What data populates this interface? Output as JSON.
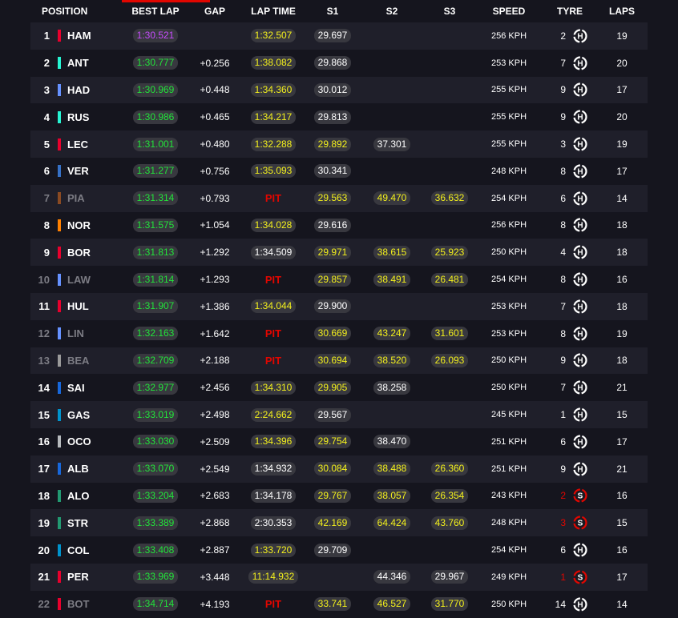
{
  "header": {
    "position": "POSITION",
    "best_lap": "BEST LAP",
    "gap": "GAP",
    "lap_time": "LAP TIME",
    "s1": "S1",
    "s2": "S2",
    "s3": "S3",
    "speed": "SPEED",
    "tyre": "TYRE",
    "laps": "LAPS"
  },
  "colors": {
    "background": "#15151e",
    "row_alt": "#1f1f2a",
    "pill": "#38383f",
    "green": "#22e33a",
    "purple": "#c84cff",
    "yellow": "#f3f01c",
    "red": "#e10600"
  },
  "pit_label": "PIT",
  "rows": [
    {
      "pos": "1",
      "driver": "HAM",
      "team_color": "#e8002d",
      "best": "1:30.521",
      "best_color": "purple",
      "gap": "",
      "lap": "1:32.507",
      "lap_color": "yellow",
      "s1": "29.697",
      "s1_color": "white",
      "s2": "",
      "s2_color": "",
      "s3": "",
      "s3_color": "",
      "speed": "256 KPH",
      "tyre_laps": "2",
      "tyre": "H",
      "laps": "19",
      "dim": false
    },
    {
      "pos": "2",
      "driver": "ANT",
      "team_color": "#27f4d2",
      "best": "1:30.777",
      "best_color": "green",
      "gap": "+0.256",
      "lap": "1:38.082",
      "lap_color": "yellow",
      "s1": "29.868",
      "s1_color": "white",
      "s2": "",
      "s2_color": "",
      "s3": "",
      "s3_color": "",
      "speed": "253 KPH",
      "tyre_laps": "7",
      "tyre": "H",
      "laps": "20",
      "dim": false
    },
    {
      "pos": "3",
      "driver": "HAD",
      "team_color": "#6692ff",
      "best": "1:30.969",
      "best_color": "green",
      "gap": "+0.448",
      "lap": "1:34.360",
      "lap_color": "yellow",
      "s1": "30.012",
      "s1_color": "white",
      "s2": "",
      "s2_color": "",
      "s3": "",
      "s3_color": "",
      "speed": "255 KPH",
      "tyre_laps": "9",
      "tyre": "H",
      "laps": "17",
      "dim": false
    },
    {
      "pos": "4",
      "driver": "RUS",
      "team_color": "#27f4d2",
      "best": "1:30.986",
      "best_color": "green",
      "gap": "+0.465",
      "lap": "1:34.217",
      "lap_color": "yellow",
      "s1": "29.813",
      "s1_color": "white",
      "s2": "",
      "s2_color": "",
      "s3": "",
      "s3_color": "",
      "speed": "255 KPH",
      "tyre_laps": "9",
      "tyre": "H",
      "laps": "20",
      "dim": false
    },
    {
      "pos": "5",
      "driver": "LEC",
      "team_color": "#e8002d",
      "best": "1:31.001",
      "best_color": "green",
      "gap": "+0.480",
      "lap": "1:32.288",
      "lap_color": "yellow",
      "s1": "29.892",
      "s1_color": "yellow",
      "s2": "37.301",
      "s2_color": "white",
      "s3": "",
      "s3_color": "",
      "speed": "255 KPH",
      "tyre_laps": "3",
      "tyre": "H",
      "laps": "19",
      "dim": false
    },
    {
      "pos": "6",
      "driver": "VER",
      "team_color": "#3671c6",
      "best": "1:31.277",
      "best_color": "green",
      "gap": "+0.756",
      "lap": "1:35.093",
      "lap_color": "yellow",
      "s1": "30.341",
      "s1_color": "white",
      "s2": "",
      "s2_color": "",
      "s3": "",
      "s3_color": "",
      "speed": "248 KPH",
      "tyre_laps": "8",
      "tyre": "H",
      "laps": "17",
      "dim": false
    },
    {
      "pos": "7",
      "driver": "PIA",
      "team_color": "#8a4a22",
      "best": "1:31.314",
      "best_color": "green",
      "gap": "+0.793",
      "lap": "PIT",
      "lap_color": "pit",
      "s1": "29.563",
      "s1_color": "yellow",
      "s2": "49.470",
      "s2_color": "yellow",
      "s3": "36.632",
      "s3_color": "yellow",
      "speed": "254 KPH",
      "tyre_laps": "6",
      "tyre": "H",
      "laps": "14",
      "dim": true
    },
    {
      "pos": "8",
      "driver": "NOR",
      "team_color": "#ff8000",
      "best": "1:31.575",
      "best_color": "green",
      "gap": "+1.054",
      "lap": "1:34.028",
      "lap_color": "yellow",
      "s1": "29.616",
      "s1_color": "white",
      "s2": "",
      "s2_color": "",
      "s3": "",
      "s3_color": "",
      "speed": "256 KPH",
      "tyre_laps": "8",
      "tyre": "H",
      "laps": "18",
      "dim": false
    },
    {
      "pos": "9",
      "driver": "BOR",
      "team_color": "#e8002d",
      "best": "1:31.813",
      "best_color": "green",
      "gap": "+1.292",
      "lap": "1:34.509",
      "lap_color": "white",
      "s1": "29.971",
      "s1_color": "yellow",
      "s2": "38.615",
      "s2_color": "yellow",
      "s3": "25.923",
      "s3_color": "yellow",
      "speed": "250 KPH",
      "tyre_laps": "4",
      "tyre": "H",
      "laps": "18",
      "dim": false
    },
    {
      "pos": "10",
      "driver": "LAW",
      "team_color": "#6692ff",
      "best": "1:31.814",
      "best_color": "green",
      "gap": "+1.293",
      "lap": "PIT",
      "lap_color": "pit",
      "s1": "29.857",
      "s1_color": "yellow",
      "s2": "38.491",
      "s2_color": "yellow",
      "s3": "26.481",
      "s3_color": "yellow",
      "speed": "254 KPH",
      "tyre_laps": "8",
      "tyre": "H",
      "laps": "16",
      "dim": true
    },
    {
      "pos": "11",
      "driver": "HUL",
      "team_color": "#e8002d",
      "best": "1:31.907",
      "best_color": "green",
      "gap": "+1.386",
      "lap": "1:34.044",
      "lap_color": "yellow",
      "s1": "29.900",
      "s1_color": "white",
      "s2": "",
      "s2_color": "",
      "s3": "",
      "s3_color": "",
      "speed": "253 KPH",
      "tyre_laps": "7",
      "tyre": "H",
      "laps": "18",
      "dim": false
    },
    {
      "pos": "12",
      "driver": "LIN",
      "team_color": "#6692ff",
      "best": "1:32.163",
      "best_color": "green",
      "gap": "+1.642",
      "lap": "PIT",
      "lap_color": "pit",
      "s1": "30.669",
      "s1_color": "yellow",
      "s2": "43.247",
      "s2_color": "yellow",
      "s3": "31.601",
      "s3_color": "yellow",
      "speed": "253 KPH",
      "tyre_laps": "8",
      "tyre": "H",
      "laps": "19",
      "dim": true
    },
    {
      "pos": "13",
      "driver": "BEA",
      "team_color": "#9a9a9a",
      "best": "1:32.709",
      "best_color": "green",
      "gap": "+2.188",
      "lap": "PIT",
      "lap_color": "pit",
      "s1": "30.694",
      "s1_color": "yellow",
      "s2": "38.520",
      "s2_color": "yellow",
      "s3": "26.093",
      "s3_color": "yellow",
      "speed": "250 KPH",
      "tyre_laps": "9",
      "tyre": "H",
      "laps": "18",
      "dim": true
    },
    {
      "pos": "14",
      "driver": "SAI",
      "team_color": "#1868db",
      "best": "1:32.977",
      "best_color": "green",
      "gap": "+2.456",
      "lap": "1:34.310",
      "lap_color": "yellow",
      "s1": "29.905",
      "s1_color": "yellow",
      "s2": "38.258",
      "s2_color": "white",
      "s3": "",
      "s3_color": "",
      "speed": "250 KPH",
      "tyre_laps": "7",
      "tyre": "H",
      "laps": "21",
      "dim": false
    },
    {
      "pos": "15",
      "driver": "GAS",
      "team_color": "#0093cc",
      "best": "1:33.019",
      "best_color": "green",
      "gap": "+2.498",
      "lap": "2:24.662",
      "lap_color": "yellow",
      "s1": "29.567",
      "s1_color": "white",
      "s2": "",
      "s2_color": "",
      "s3": "",
      "s3_color": "",
      "speed": "245 KPH",
      "tyre_laps": "1",
      "tyre": "H",
      "laps": "15",
      "dim": false
    },
    {
      "pos": "16",
      "driver": "OCO",
      "team_color": "#b6babd",
      "best": "1:33.030",
      "best_color": "green",
      "gap": "+2.509",
      "lap": "1:34.396",
      "lap_color": "yellow",
      "s1": "29.754",
      "s1_color": "yellow",
      "s2": "38.470",
      "s2_color": "white",
      "s3": "",
      "s3_color": "",
      "speed": "251 KPH",
      "tyre_laps": "6",
      "tyre": "H",
      "laps": "17",
      "dim": false
    },
    {
      "pos": "17",
      "driver": "ALB",
      "team_color": "#1868db",
      "best": "1:33.070",
      "best_color": "green",
      "gap": "+2.549",
      "lap": "1:34.932",
      "lap_color": "white",
      "s1": "30.084",
      "s1_color": "yellow",
      "s2": "38.488",
      "s2_color": "yellow",
      "s3": "26.360",
      "s3_color": "yellow",
      "speed": "251 KPH",
      "tyre_laps": "9",
      "tyre": "H",
      "laps": "21",
      "dim": false
    },
    {
      "pos": "18",
      "driver": "ALO",
      "team_color": "#229971",
      "best": "1:33.204",
      "best_color": "green",
      "gap": "+2.683",
      "lap": "1:34.178",
      "lap_color": "white",
      "s1": "29.767",
      "s1_color": "yellow",
      "s2": "38.057",
      "s2_color": "yellow",
      "s3": "26.354",
      "s3_color": "yellow",
      "speed": "243 KPH",
      "tyre_laps": "2",
      "tyre": "S",
      "laps": "16",
      "dim": false
    },
    {
      "pos": "19",
      "driver": "STR",
      "team_color": "#229971",
      "best": "1:33.389",
      "best_color": "green",
      "gap": "+2.868",
      "lap": "2:30.353",
      "lap_color": "white",
      "s1": "42.169",
      "s1_color": "yellow",
      "s2": "64.424",
      "s2_color": "yellow",
      "s3": "43.760",
      "s3_color": "yellow",
      "speed": "248 KPH",
      "tyre_laps": "3",
      "tyre": "S",
      "laps": "15",
      "dim": false
    },
    {
      "pos": "20",
      "driver": "COL",
      "team_color": "#0093cc",
      "best": "1:33.408",
      "best_color": "green",
      "gap": "+2.887",
      "lap": "1:33.720",
      "lap_color": "yellow",
      "s1": "29.709",
      "s1_color": "white",
      "s2": "",
      "s2_color": "",
      "s3": "",
      "s3_color": "",
      "speed": "254 KPH",
      "tyre_laps": "6",
      "tyre": "H",
      "laps": "16",
      "dim": false
    },
    {
      "pos": "21",
      "driver": "PER",
      "team_color": "#e8002d",
      "best": "1:33.969",
      "best_color": "green",
      "gap": "+3.448",
      "lap": "11:14.932",
      "lap_color": "yellow",
      "s1": "",
      "s1_color": "",
      "s2": "44.346",
      "s2_color": "white",
      "s3": "29.967",
      "s3_color": "white",
      "speed": "249 KPH",
      "tyre_laps": "1",
      "tyre": "S",
      "laps": "17",
      "dim": false
    },
    {
      "pos": "22",
      "driver": "BOT",
      "team_color": "#e8002d",
      "best": "1:34.714",
      "best_color": "green",
      "gap": "+4.193",
      "lap": "PIT",
      "lap_color": "pit",
      "s1": "33.741",
      "s1_color": "yellow",
      "s2": "46.527",
      "s2_color": "yellow",
      "s3": "31.770",
      "s3_color": "yellow",
      "speed": "250 KPH",
      "tyre_laps": "14",
      "tyre": "H",
      "laps": "14",
      "dim": true
    }
  ]
}
